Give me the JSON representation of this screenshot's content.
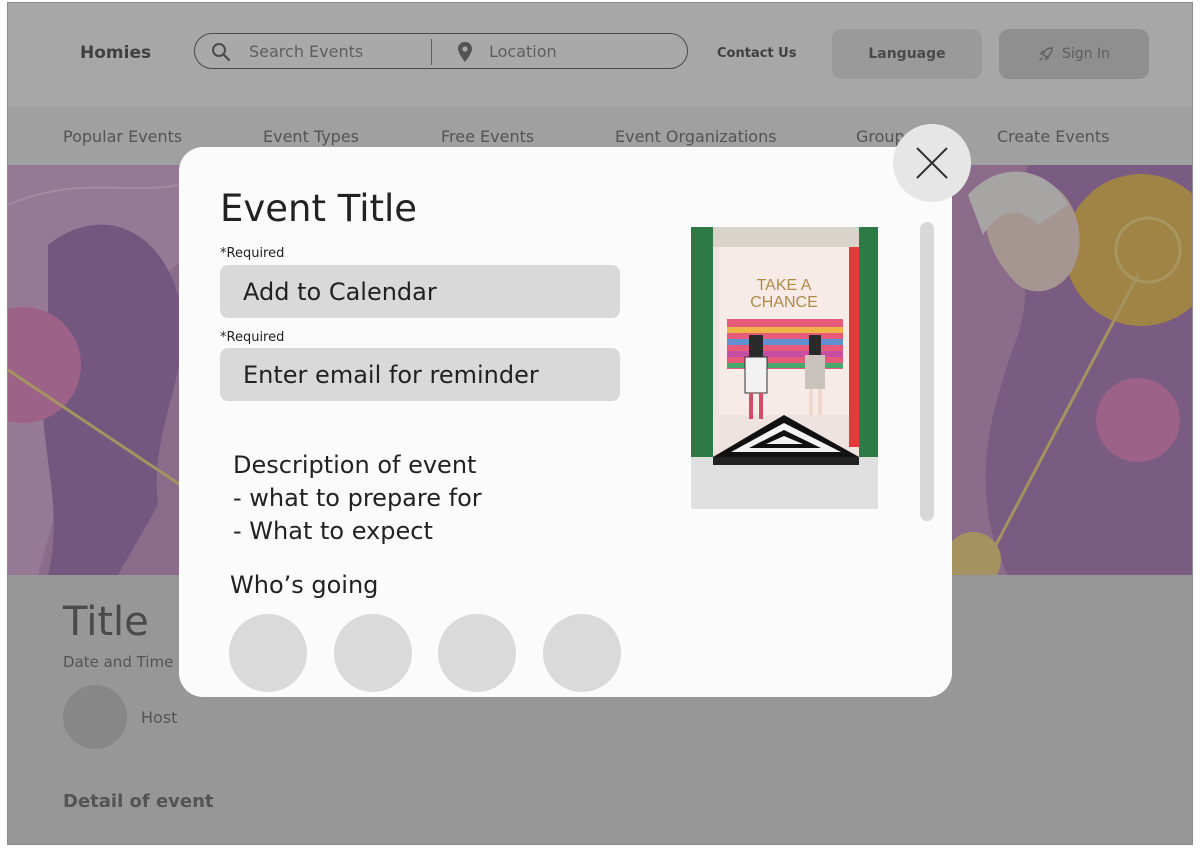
{
  "header": {
    "logo": "Homies",
    "search_placeholder": "Search Events",
    "location_placeholder": "Location",
    "contact": "Contact Us",
    "language": "Language",
    "sign_in": "Sign In"
  },
  "nav": {
    "items": [
      "Popular Events",
      "Event Types",
      "Free Events",
      "Event Organizations",
      "Groups",
      "Create Events"
    ]
  },
  "detail": {
    "title": "Title",
    "date_time": "Date and Time",
    "host": "Host",
    "detail_label": "Detail of event"
  },
  "modal": {
    "title": "Event Title",
    "required_1": "*Required",
    "calendar_field": "Add to Calendar",
    "required_2": "*Required",
    "email_field": "Enter email for reminder",
    "description_lines": [
      "Description of event",
      "- what to prepare for",
      "- What to expect"
    ],
    "whos_going": "Who’s going",
    "photo_sign": [
      "TAKE A",
      "CHANCE"
    ]
  },
  "colors": {
    "hero_base": "#b57fb9",
    "hero_accent": "#e9b94f",
    "overlay": "rgba(60,60,60,0.42)",
    "field": "#d9d9d9"
  },
  "icons": [
    "search-icon",
    "location-pin-icon",
    "rocket-icon",
    "close-icon"
  ]
}
